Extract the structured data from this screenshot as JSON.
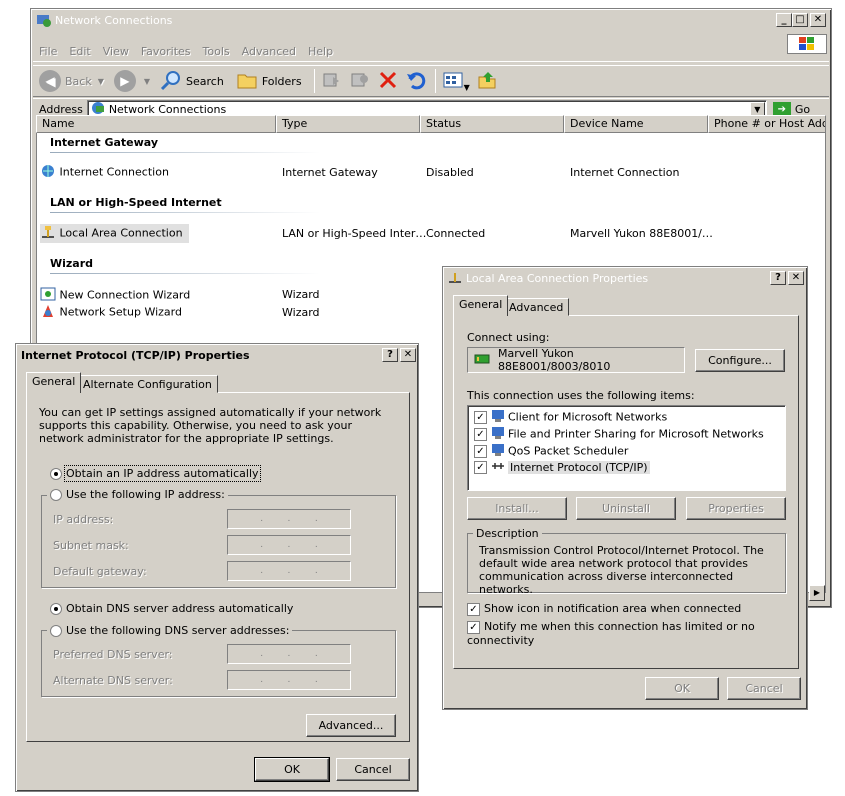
{
  "network_window": {
    "title": "Network Connections",
    "menu": [
      "File",
      "Edit",
      "View",
      "Favorites",
      "Tools",
      "Advanced",
      "Help"
    ],
    "toolbar": {
      "back": "Back",
      "search": "Search",
      "folders": "Folders"
    },
    "address_label": "Address",
    "address_value": "Network Connections",
    "go_label": "Go",
    "columns": [
      "Name",
      "Type",
      "Status",
      "Device Name",
      "Phone # or Host Address"
    ],
    "groups": [
      {
        "title": "Internet Gateway",
        "items": [
          {
            "name": "Internet Connection",
            "type": "Internet Gateway",
            "status": "Disabled",
            "device": "Internet Connection"
          }
        ]
      },
      {
        "title": "LAN or High-Speed Internet",
        "items": [
          {
            "name": "Local Area Connection",
            "type": "LAN or High-Speed Inter…",
            "status": "Connected",
            "device": "Marvell Yukon 88E8001/…"
          }
        ]
      },
      {
        "title": "Wizard",
        "items": [
          {
            "name": "New Connection Wizard",
            "type": "Wizard",
            "status": "",
            "device": ""
          },
          {
            "name": "Network Setup Wizard",
            "type": "Wizard",
            "status": "",
            "device": ""
          }
        ]
      }
    ]
  },
  "lac_dialog": {
    "title": "Local Area Connection Properties",
    "tabs": [
      "General",
      "Advanced"
    ],
    "connect_using_label": "Connect using:",
    "adapter": "Marvell Yukon 88E8001/8003/8010",
    "configure": "Configure...",
    "items_label": "This connection uses the following items:",
    "items": [
      {
        "label": "Client for Microsoft Networks",
        "checked": true
      },
      {
        "label": "File and Printer Sharing for Microsoft Networks",
        "checked": true
      },
      {
        "label": "QoS Packet Scheduler",
        "checked": true
      },
      {
        "label": "Internet Protocol (TCP/IP)",
        "checked": true
      }
    ],
    "install": "Install...",
    "uninstall": "Uninstall",
    "properties": "Properties",
    "description_label": "Description",
    "description": "Transmission Control Protocol/Internet Protocol. The default wide area network protocol that provides communication across diverse interconnected networks.",
    "show_icon": "Show icon in notification area when connected",
    "notify": "Notify me when this connection has limited or no connectivity",
    "ok": "OK",
    "cancel": "Cancel"
  },
  "tcp_dialog": {
    "title": "Internet Protocol (TCP/IP) Properties",
    "tabs": [
      "General",
      "Alternate Configuration"
    ],
    "intro": "You can get IP settings assigned automatically if your network supports this capability. Otherwise, you need to ask your network administrator for the appropriate IP settings.",
    "obtain_ip": "Obtain an IP address automatically",
    "use_ip": "Use the following IP address:",
    "ip_address": "IP address:",
    "subnet_mask": "Subnet mask:",
    "default_gateway": "Default gateway:",
    "obtain_dns": "Obtain DNS server address automatically",
    "use_dns": "Use the following DNS server addresses:",
    "preferred_dns": "Preferred DNS server:",
    "alternate_dns": "Alternate DNS server:",
    "advanced": "Advanced...",
    "ok": "OK",
    "cancel": "Cancel"
  }
}
